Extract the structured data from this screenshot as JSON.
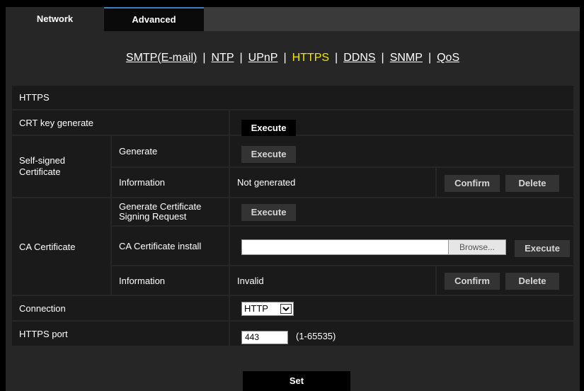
{
  "tabs": {
    "network": "Network",
    "advanced": "Advanced"
  },
  "subnav": {
    "smtp": "SMTP(E-mail)",
    "ntp": "NTP",
    "upnp": "UPnP",
    "https": "HTTPS",
    "ddns": "DDNS",
    "snmp": "SNMP",
    "qos": "QoS",
    "separator": "|"
  },
  "section_title": "HTTPS",
  "crt": {
    "label": "CRT key generate",
    "button": "Execute"
  },
  "self_signed": {
    "label": "Self-signed Certificate",
    "generate_label": "Generate",
    "generate_button": "Execute",
    "info_label": "Information",
    "info_value": "Not generated",
    "confirm": "Confirm",
    "delete": "Delete"
  },
  "ca": {
    "label": "CA Certificate",
    "csr_label": "Generate Certificate Signing Request",
    "csr_button": "Execute",
    "install_label": "CA Certificate install",
    "install_value": "",
    "browse": "Browse...",
    "install_button": "Execute",
    "info_label": "Information",
    "info_value": "Invalid",
    "confirm": "Confirm",
    "delete": "Delete"
  },
  "connection": {
    "label": "Connection",
    "value": "HTTP"
  },
  "https_port": {
    "label": "HTTPS port",
    "value": "443",
    "range": "(1-65535)"
  },
  "set_button": "Set",
  "colors": {
    "active_link": "#f2e600",
    "tab_accent": "#3b7fc4",
    "panel": "#262626",
    "cell": "#1a1a1a"
  }
}
